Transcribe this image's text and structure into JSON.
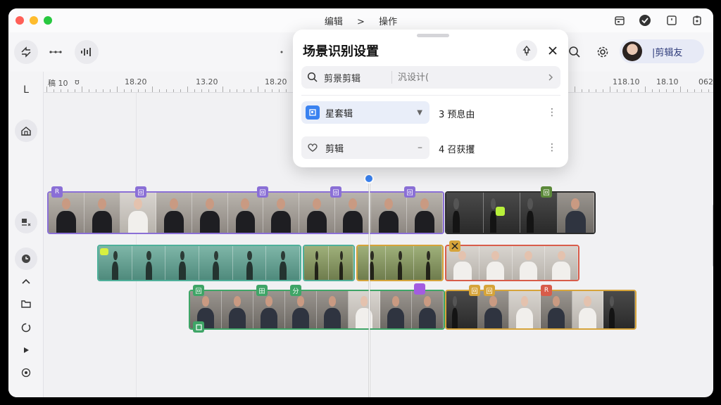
{
  "window": {
    "breadcrumb": [
      "编辑",
      "操作"
    ],
    "breadcrumb_separator": ">"
  },
  "toolbar": {
    "user_name": "|剪辑友"
  },
  "ruler": {
    "labels": [
      "",
      "18.20",
      "13.20",
      "18.20",
      "118.10",
      "18.10",
      "062"
    ],
    "left_label": "稿 10",
    "left_sub": "ʊ"
  },
  "leftbar": {
    "top_label": "L"
  },
  "popover": {
    "title": "场景识别设置",
    "search_label": "剪景剪辑",
    "search_placeholder": "汎设计(",
    "rows": [
      {
        "label": "星套辑",
        "status": "3 预息由",
        "icon": "picture-icon",
        "accent": "#3a82f0"
      },
      {
        "label": "剪辑",
        "status": "4 召获攫",
        "icon": "heart-icon",
        "accent": "#666666"
      }
    ]
  },
  "tracks": {
    "badges_row1": [
      "R",
      "回",
      "回",
      "回",
      "回",
      "回"
    ],
    "badges_row3": [
      "回",
      "田",
      "分",
      "回",
      "回",
      "R"
    ],
    "colors": {
      "purple": "#8a6fd6",
      "teal": "#4fb09a",
      "gold": "#d6a43a",
      "red": "#d85c4a",
      "green": "#3fa567",
      "dark": "#2d2d2d"
    }
  }
}
